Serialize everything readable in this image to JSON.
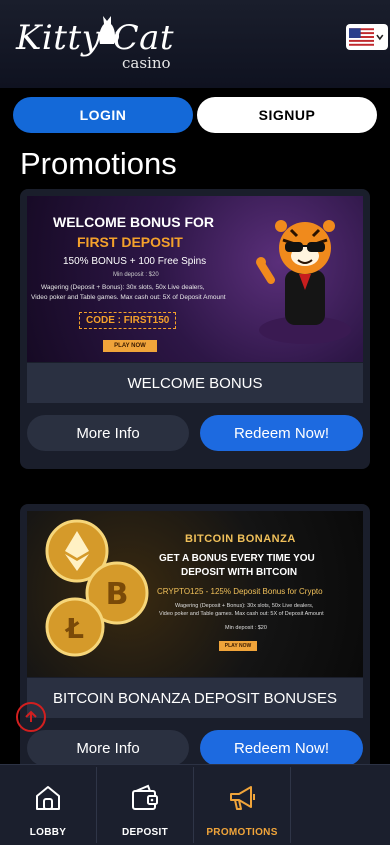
{
  "header": {
    "logo_main": "Kitty Cat",
    "logo_sub": "casino",
    "language_flag": "us-flag"
  },
  "auth": {
    "login_label": "LOGIN",
    "signup_label": "SIGNUP"
  },
  "page_title": "Promotions",
  "promotions": [
    {
      "banner": {
        "line1": "WELCOME BONUS FOR",
        "line2": "FIRST DEPOSIT",
        "line3": "150% BONUS + 100 Free Spins",
        "line4": "Min deposit : $20",
        "line5": "Wagering (Deposit + Bonus): 30x slots, 50x Live dealers,",
        "line6": "Video poker and Table games. Max cash out: 5X of Deposit Amount",
        "code": "CODE : FIRST150",
        "play_label": "PLAY NOW"
      },
      "title": "WELCOME BONUS",
      "more_label": "More Info",
      "redeem_label": "Redeem Now!"
    },
    {
      "banner": {
        "line1": "BITCOIN BONANZA",
        "line2": "GET A BONUS EVERY TIME YOU",
        "line3": "DEPOSIT WITH BITCOIN",
        "line4": "CRYPTO125 - 125% Deposit Bonus for Crypto",
        "line5": "Wagering (Deposit + Bonus): 30x slots, 50x Live dealers,",
        "line6": "Video poker and Table games. Max cash out: 5X of Deposit Amount",
        "line7": "Min deposit : $20",
        "play_label": "PLAY NOW"
      },
      "title": "BITCOIN BONANZA DEPOSIT BONUSES",
      "more_label": "More Info",
      "redeem_label": "Redeem Now!"
    }
  ],
  "nav": {
    "lobby": "LOBBY",
    "deposit": "DEPOSIT",
    "promotions": "PROMOTIONS",
    "active": "promotions"
  },
  "colors": {
    "accent": "#1d6ae0",
    "active_nav": "#f0a43a",
    "card_bg": "#1a1e2b"
  }
}
